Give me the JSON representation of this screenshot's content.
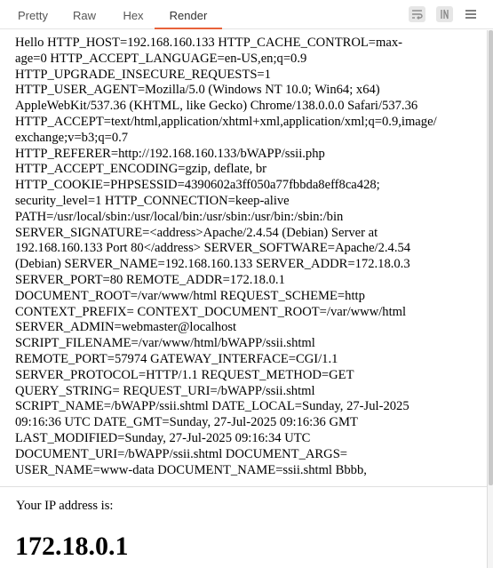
{
  "tabs": [
    {
      "label": "Pretty"
    },
    {
      "label": "Raw"
    },
    {
      "label": "Hex"
    },
    {
      "label": "Render"
    }
  ],
  "active_tab": "Render",
  "accent_color": "#e8623a",
  "toolbar": {
    "icons": [
      "word-wrap-icon",
      "newline-toggle-icon",
      "menu-icon"
    ]
  },
  "render": {
    "body_text": "Hello HTTP_HOST=192.168.160.133 HTTP_CACHE_CONTROL=max-\nage=0 HTTP_ACCEPT_LANGUAGE=en-US,en;q=0.9\nHTTP_UPGRADE_INSECURE_REQUESTS=1\nHTTP_USER_AGENT=Mozilla/5.0 (Windows NT 10.0; Win64; x64)\nAppleWebKit/537.36 (KHTML, like Gecko) Chrome/138.0.0.0 Safari/537.36\nHTTP_ACCEPT=text/html,application/xhtml+xml,application/xml;q=0.9,image/\nexchange;v=b3;q=0.7\nHTTP_REFERER=http://192.168.160.133/bWAPP/ssii.php\nHTTP_ACCEPT_ENCODING=gzip, deflate, br\nHTTP_COOKIE=PHPSESSID=4390602a3ff050a77fbbda8eff8ca428;\nsecurity_level=1 HTTP_CONNECTION=keep-alive\nPATH=/usr/local/sbin:/usr/local/bin:/usr/sbin:/usr/bin:/sbin:/bin\nSERVER_SIGNATURE=<address>Apache/2.4.54 (Debian) Server at\n192.168.160.133 Port 80</address> SERVER_SOFTWARE=Apache/2.4.54\n(Debian) SERVER_NAME=192.168.160.133 SERVER_ADDR=172.18.0.3\nSERVER_PORT=80 REMOTE_ADDR=172.18.0.1\nDOCUMENT_ROOT=/var/www/html REQUEST_SCHEME=http\nCONTEXT_PREFIX= CONTEXT_DOCUMENT_ROOT=/var/www/html\nSERVER_ADMIN=webmaster@localhost\nSCRIPT_FILENAME=/var/www/html/bWAPP/ssii.shtml\nREMOTE_PORT=57974 GATEWAY_INTERFACE=CGI/1.1\nSERVER_PROTOCOL=HTTP/1.1 REQUEST_METHOD=GET\nQUERY_STRING= REQUEST_URI=/bWAPP/ssii.shtml\nSCRIPT_NAME=/bWAPP/ssii.shtml DATE_LOCAL=Sunday, 27-Jul-2025\n09:16:36 UTC DATE_GMT=Sunday, 27-Jul-2025 09:16:36 GMT\nLAST_MODIFIED=Sunday, 27-Jul-2025 09:16:34 UTC\nDOCUMENT_URI=/bWAPP/ssii.shtml DOCUMENT_ARGS=\nUSER_NAME=www-data DOCUMENT_NAME=ssii.shtml Bbbb,",
    "ip_label": "Your IP address is:",
    "ip_value": "172.18.0.1"
  }
}
